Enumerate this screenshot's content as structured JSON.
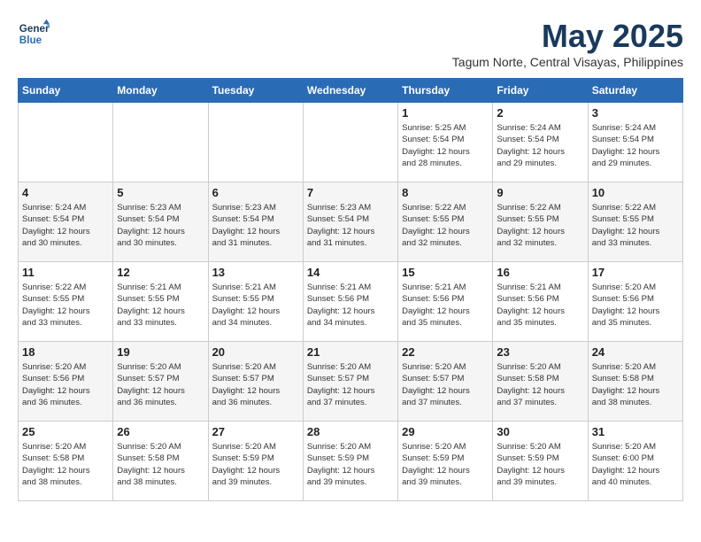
{
  "logo": {
    "line1": "General",
    "line2": "Blue"
  },
  "title": "May 2025",
  "subtitle": "Tagum Norte, Central Visayas, Philippines",
  "weekdays": [
    "Sunday",
    "Monday",
    "Tuesday",
    "Wednesday",
    "Thursday",
    "Friday",
    "Saturday"
  ],
  "weeks": [
    [
      {
        "day": "",
        "info": ""
      },
      {
        "day": "",
        "info": ""
      },
      {
        "day": "",
        "info": ""
      },
      {
        "day": "",
        "info": ""
      },
      {
        "day": "1",
        "info": "Sunrise: 5:25 AM\nSunset: 5:54 PM\nDaylight: 12 hours\nand 28 minutes."
      },
      {
        "day": "2",
        "info": "Sunrise: 5:24 AM\nSunset: 5:54 PM\nDaylight: 12 hours\nand 29 minutes."
      },
      {
        "day": "3",
        "info": "Sunrise: 5:24 AM\nSunset: 5:54 PM\nDaylight: 12 hours\nand 29 minutes."
      }
    ],
    [
      {
        "day": "4",
        "info": "Sunrise: 5:24 AM\nSunset: 5:54 PM\nDaylight: 12 hours\nand 30 minutes."
      },
      {
        "day": "5",
        "info": "Sunrise: 5:23 AM\nSunset: 5:54 PM\nDaylight: 12 hours\nand 30 minutes."
      },
      {
        "day": "6",
        "info": "Sunrise: 5:23 AM\nSunset: 5:54 PM\nDaylight: 12 hours\nand 31 minutes."
      },
      {
        "day": "7",
        "info": "Sunrise: 5:23 AM\nSunset: 5:54 PM\nDaylight: 12 hours\nand 31 minutes."
      },
      {
        "day": "8",
        "info": "Sunrise: 5:22 AM\nSunset: 5:55 PM\nDaylight: 12 hours\nand 32 minutes."
      },
      {
        "day": "9",
        "info": "Sunrise: 5:22 AM\nSunset: 5:55 PM\nDaylight: 12 hours\nand 32 minutes."
      },
      {
        "day": "10",
        "info": "Sunrise: 5:22 AM\nSunset: 5:55 PM\nDaylight: 12 hours\nand 33 minutes."
      }
    ],
    [
      {
        "day": "11",
        "info": "Sunrise: 5:22 AM\nSunset: 5:55 PM\nDaylight: 12 hours\nand 33 minutes."
      },
      {
        "day": "12",
        "info": "Sunrise: 5:21 AM\nSunset: 5:55 PM\nDaylight: 12 hours\nand 33 minutes."
      },
      {
        "day": "13",
        "info": "Sunrise: 5:21 AM\nSunset: 5:55 PM\nDaylight: 12 hours\nand 34 minutes."
      },
      {
        "day": "14",
        "info": "Sunrise: 5:21 AM\nSunset: 5:56 PM\nDaylight: 12 hours\nand 34 minutes."
      },
      {
        "day": "15",
        "info": "Sunrise: 5:21 AM\nSunset: 5:56 PM\nDaylight: 12 hours\nand 35 minutes."
      },
      {
        "day": "16",
        "info": "Sunrise: 5:21 AM\nSunset: 5:56 PM\nDaylight: 12 hours\nand 35 minutes."
      },
      {
        "day": "17",
        "info": "Sunrise: 5:20 AM\nSunset: 5:56 PM\nDaylight: 12 hours\nand 35 minutes."
      }
    ],
    [
      {
        "day": "18",
        "info": "Sunrise: 5:20 AM\nSunset: 5:56 PM\nDaylight: 12 hours\nand 36 minutes."
      },
      {
        "day": "19",
        "info": "Sunrise: 5:20 AM\nSunset: 5:57 PM\nDaylight: 12 hours\nand 36 minutes."
      },
      {
        "day": "20",
        "info": "Sunrise: 5:20 AM\nSunset: 5:57 PM\nDaylight: 12 hours\nand 36 minutes."
      },
      {
        "day": "21",
        "info": "Sunrise: 5:20 AM\nSunset: 5:57 PM\nDaylight: 12 hours\nand 37 minutes."
      },
      {
        "day": "22",
        "info": "Sunrise: 5:20 AM\nSunset: 5:57 PM\nDaylight: 12 hours\nand 37 minutes."
      },
      {
        "day": "23",
        "info": "Sunrise: 5:20 AM\nSunset: 5:58 PM\nDaylight: 12 hours\nand 37 minutes."
      },
      {
        "day": "24",
        "info": "Sunrise: 5:20 AM\nSunset: 5:58 PM\nDaylight: 12 hours\nand 38 minutes."
      }
    ],
    [
      {
        "day": "25",
        "info": "Sunrise: 5:20 AM\nSunset: 5:58 PM\nDaylight: 12 hours\nand 38 minutes."
      },
      {
        "day": "26",
        "info": "Sunrise: 5:20 AM\nSunset: 5:58 PM\nDaylight: 12 hours\nand 38 minutes."
      },
      {
        "day": "27",
        "info": "Sunrise: 5:20 AM\nSunset: 5:59 PM\nDaylight: 12 hours\nand 39 minutes."
      },
      {
        "day": "28",
        "info": "Sunrise: 5:20 AM\nSunset: 5:59 PM\nDaylight: 12 hours\nand 39 minutes."
      },
      {
        "day": "29",
        "info": "Sunrise: 5:20 AM\nSunset: 5:59 PM\nDaylight: 12 hours\nand 39 minutes."
      },
      {
        "day": "30",
        "info": "Sunrise: 5:20 AM\nSunset: 5:59 PM\nDaylight: 12 hours\nand 39 minutes."
      },
      {
        "day": "31",
        "info": "Sunrise: 5:20 AM\nSunset: 6:00 PM\nDaylight: 12 hours\nand 40 minutes."
      }
    ]
  ]
}
